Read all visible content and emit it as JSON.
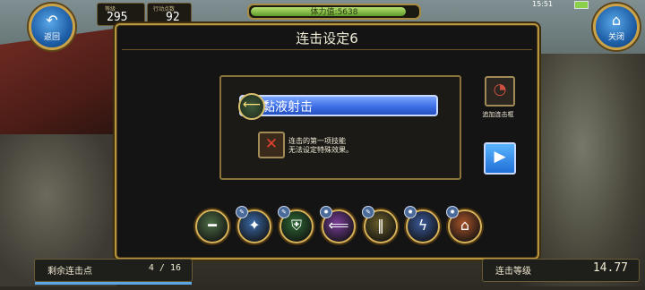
{
  "hud": {
    "back_label": "返回",
    "close_label": "关闭",
    "level_caption": "等级",
    "level_value": "295",
    "energy_caption": "行动点数",
    "energy_value": "92",
    "stamina_text": "体力值:5638",
    "stamina_fraction": 0.95,
    "clock": "15:51"
  },
  "dialog": {
    "title": "连击设定6",
    "skill_name": "黏液射击",
    "note_line1": "连击的第一项技能",
    "note_line2": "无法设定特殊效果。",
    "add_label": "追加连击框"
  },
  "skills": [
    {
      "icon": "rifle-icon",
      "glyph": "━",
      "badge": "",
      "color": "#4e6e46"
    },
    {
      "icon": "bird-strike-icon",
      "glyph": "✦",
      "badge": "✎",
      "color": "#3a6aa8"
    },
    {
      "icon": "shield-icon",
      "glyph": "⛨",
      "badge": "✎",
      "color": "#2e6a34"
    },
    {
      "icon": "arrow-left-icon",
      "glyph": "⟸",
      "badge": "✹",
      "color": "#7a3e9a"
    },
    {
      "icon": "pillars-icon",
      "glyph": "‖",
      "badge": "✎",
      "color": "#6a5e2a"
    },
    {
      "icon": "lightning-icon",
      "glyph": "ϟ",
      "badge": "✹",
      "color": "#3a5a9a"
    },
    {
      "icon": "dome-icon",
      "glyph": "⌂",
      "badge": "✹",
      "color": "#a8542a"
    }
  ],
  "bottom": {
    "points_label": "剩余连击点",
    "points_value": "4 / 16",
    "level_label": "连击等级",
    "level_value": "14.77"
  }
}
